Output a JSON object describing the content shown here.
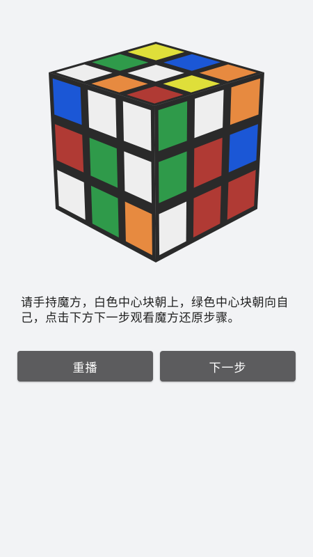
{
  "cube": {
    "colors": {
      "white": "#eeeeee",
      "yellow": "#dfdf3a",
      "red": "#b03a34",
      "orange": "#e78a40",
      "green": "#2f9a4a",
      "blue": "#1b57d6",
      "body": "#2a2a2a"
    },
    "faces": {
      "top": [
        [
          "white",
          "green",
          "yellow"
        ],
        [
          "orange",
          "white",
          "blue"
        ],
        [
          "red",
          "yellow",
          "orange"
        ]
      ],
      "left": [
        [
          "blue",
          "white",
          "white"
        ],
        [
          "red",
          "green",
          "white"
        ],
        [
          "white",
          "green",
          "orange"
        ]
      ],
      "front": [
        [
          "green",
          "white",
          "orange"
        ],
        [
          "green",
          "red",
          "blue"
        ],
        [
          "white",
          "red",
          "red"
        ]
      ]
    }
  },
  "instruction_text": "请手持魔方，白色中心块朝上，绿色中心块朝向自己，点击下方下一步观看魔方还原步骤。",
  "buttons": {
    "replay_label": "重播",
    "next_label": "下一步"
  }
}
